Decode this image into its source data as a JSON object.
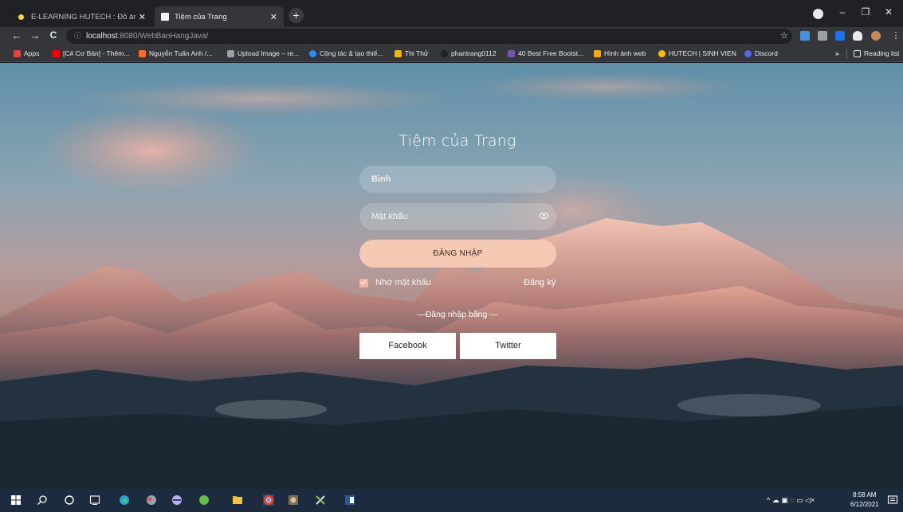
{
  "browser": {
    "tabs": [
      {
        "title": "E-LEARNING HUTECH : Đồ án java",
        "active": false
      },
      {
        "title": "Tiệm của Trang",
        "active": true
      }
    ],
    "new_tab_symbol": "+",
    "window_controls": {
      "minimize": "–",
      "restore": "❐",
      "close": "✕"
    },
    "address": {
      "host": "localhost",
      "path": ":8080/WebBanHangJava/"
    },
    "nav": {
      "back": "←",
      "forward": "→",
      "reload": "C",
      "info": "ⓘ"
    },
    "bookmarks": [
      {
        "label": "Apps",
        "color": "#ea4335"
      },
      {
        "label": "[C# Cơ Bản] - Thêm...",
        "color": "#ff0000"
      },
      {
        "label": "Nguyễn Tuấn Anh /...",
        "color": "#fc6d26"
      },
      {
        "label": "Upload Image – re...",
        "color": "#9aa0a6"
      },
      {
        "label": "Cộng tác & tạo thiế...",
        "color": "#2d8cff"
      },
      {
        "label": "Thi Thử",
        "color": "#f4b400"
      },
      {
        "label": "phantrang0112",
        "color": "#202124"
      },
      {
        "label": "40 Best Free Bootst...",
        "color": "#7952b3"
      },
      {
        "label": "Hình ảnh web",
        "color": "#f9ab00"
      },
      {
        "label": "HUTECH | SINH VIEN",
        "color": "#fbbc04"
      },
      {
        "label": "Discord",
        "color": "#5865f2"
      }
    ],
    "overflow": "»",
    "reading_list": "Reading list"
  },
  "login": {
    "brand": "Tiệm của Trang",
    "username_value": "Bình",
    "password_placeholder": "Mật khẩu",
    "submit_label": "ĐĂNG NHẬP",
    "remember_label": "Nhớ mật khẩu",
    "remember_checked": true,
    "signup_label": "Đăng ký",
    "divider_text": "—Đăng nhập bằng —",
    "facebook_label": "Facebook",
    "twitter_label": "Twitter"
  },
  "taskbar": {
    "time": "8:58 AM",
    "date": "6/12/2021",
    "tray_symbols": "^ ☁ ▣ ◌ ▭ ◁×"
  },
  "colors": {
    "accent": "#f6c9b5",
    "chrome_dark": "#202124",
    "chrome_toolbar": "#35363a",
    "taskbar": "#1c2b3d"
  }
}
